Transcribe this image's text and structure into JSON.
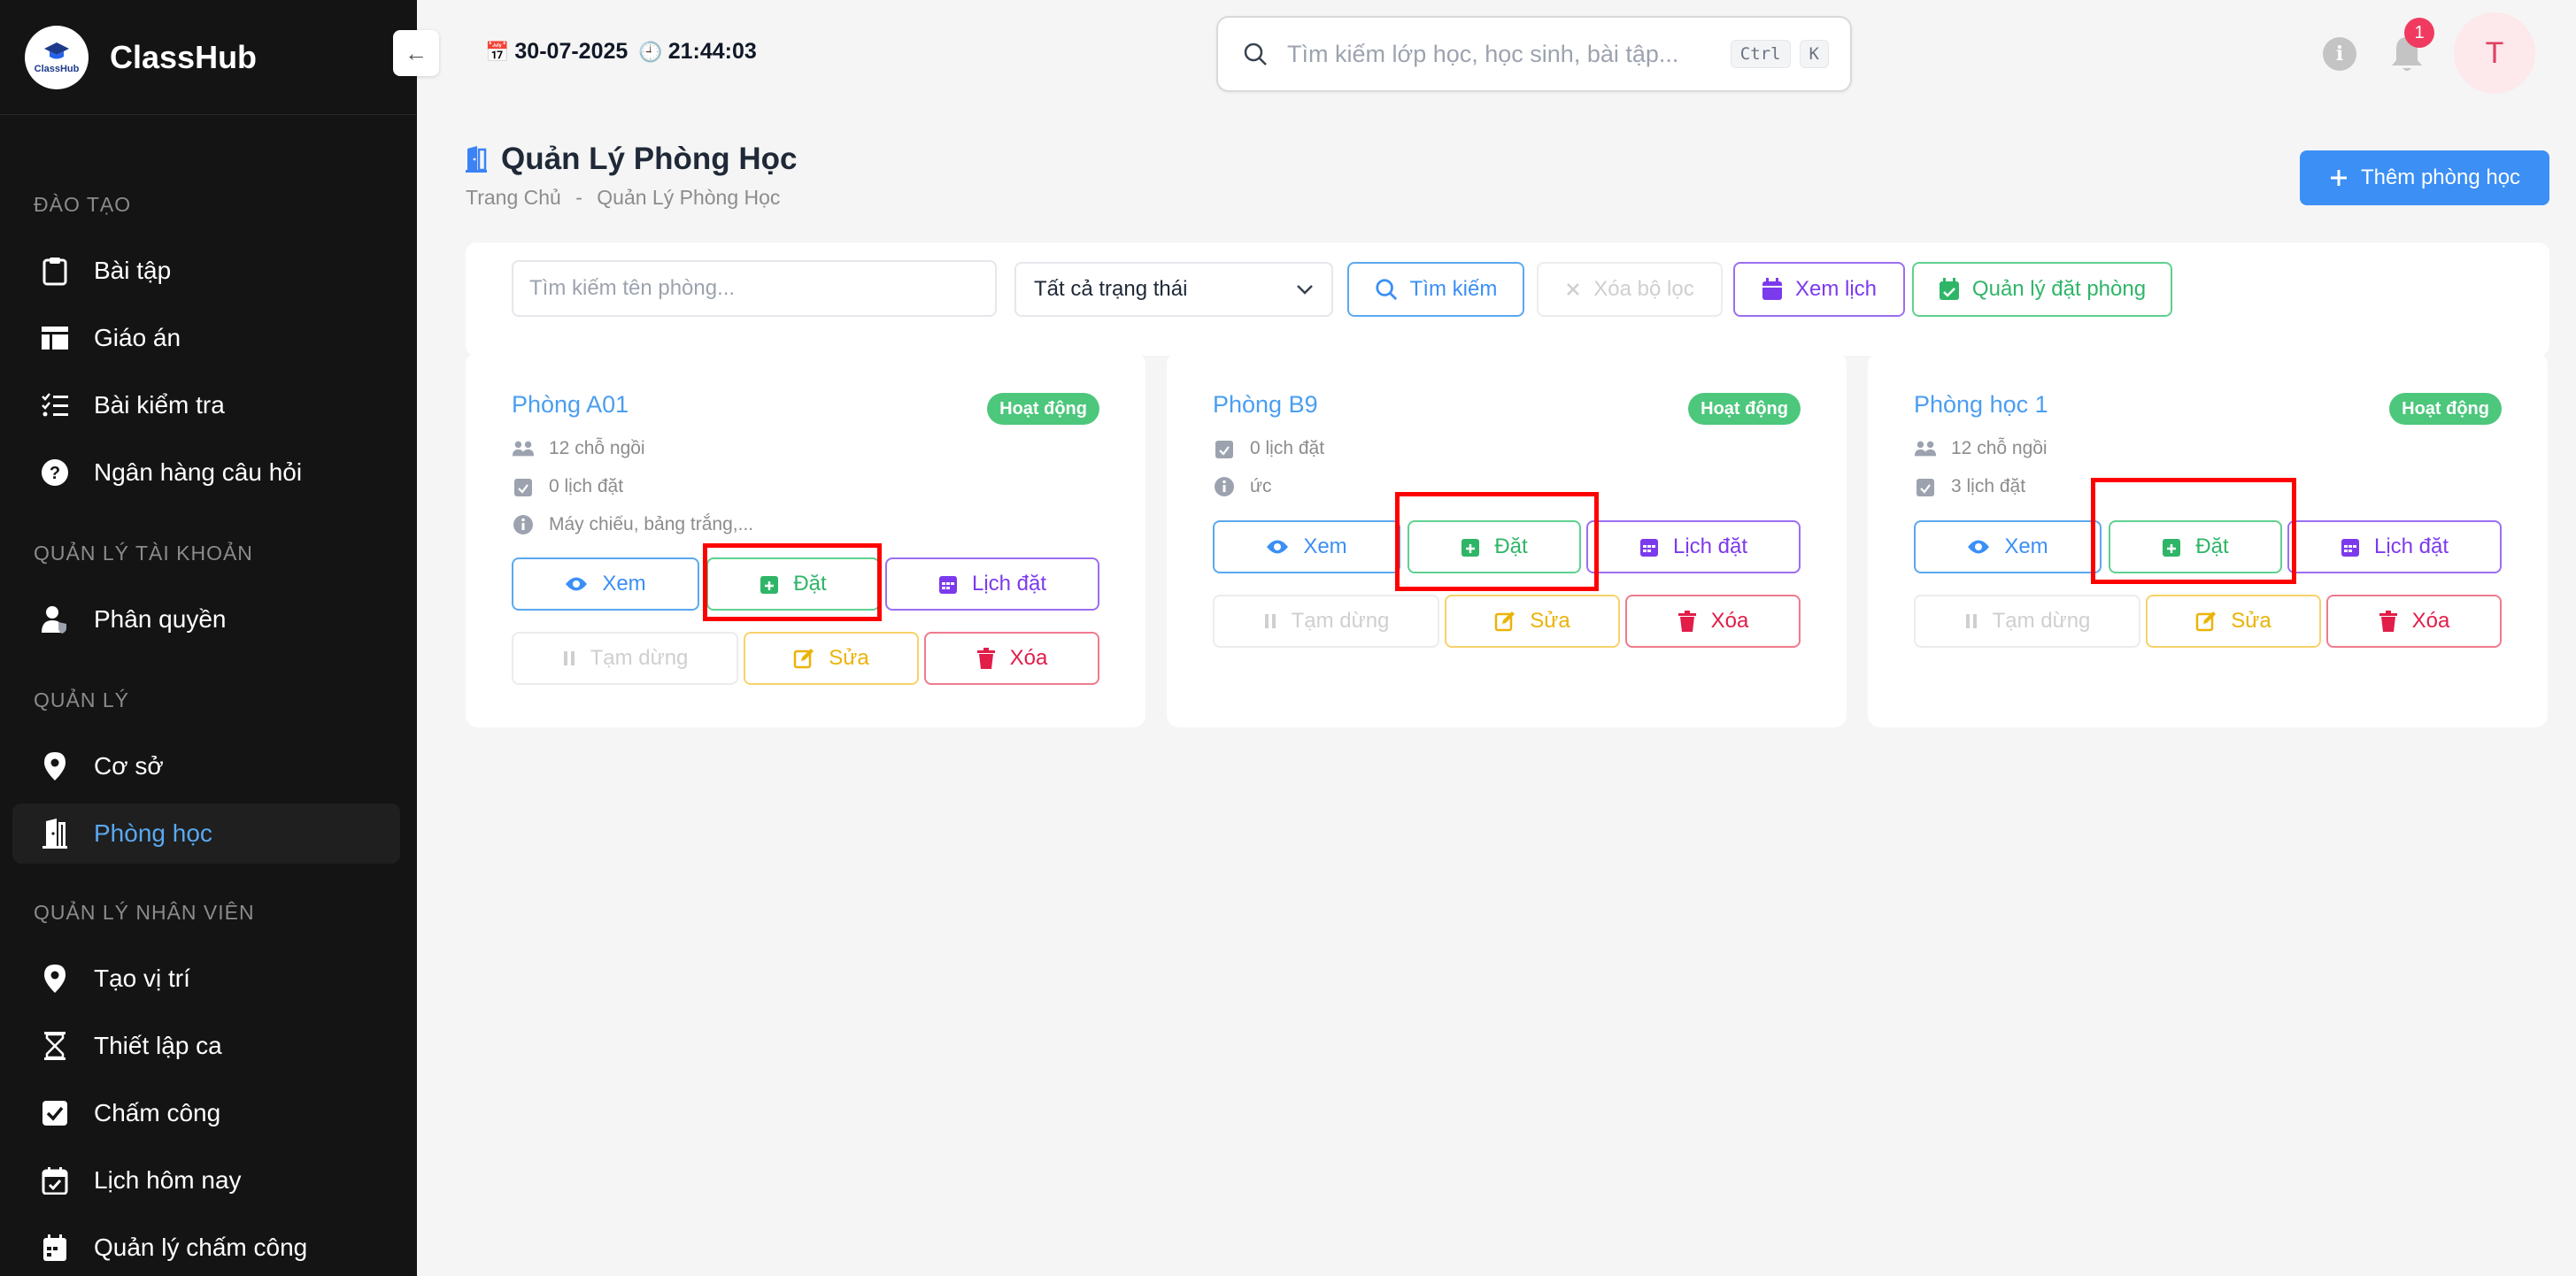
{
  "app": {
    "name": "ClassHub",
    "logo_text": "ClassHub"
  },
  "sidebar": {
    "sections": [
      {
        "title": "ĐÀO TẠO",
        "items": [
          {
            "label": "Bài tập",
            "icon": "clipboard-icon"
          },
          {
            "label": "Giáo án",
            "icon": "layout-icon"
          },
          {
            "label": "Bài kiểm tra",
            "icon": "checklist-icon"
          },
          {
            "label": "Ngân hàng câu hỏi",
            "icon": "question-circle-icon"
          }
        ]
      },
      {
        "title": "QUẢN LÝ TÀI KHOẢN",
        "items": [
          {
            "label": "Phân quyền",
            "icon": "user-shield-icon"
          }
        ]
      },
      {
        "title": "QUẢN LÝ",
        "items": [
          {
            "label": "Cơ sở",
            "icon": "map-pin-icon"
          },
          {
            "label": "Phòng học",
            "icon": "door-icon",
            "active": true
          }
        ]
      },
      {
        "title": "QUẢN LÝ NHÂN VIÊN",
        "items": [
          {
            "label": "Tạo vị trí",
            "icon": "map-pin-icon"
          },
          {
            "label": "Thiết lập ca",
            "icon": "hourglass-icon"
          },
          {
            "label": "Chấm công",
            "icon": "check-square-icon"
          },
          {
            "label": "Lịch hôm nay",
            "icon": "calendar-check-icon"
          },
          {
            "label": "Quản lý chấm công",
            "icon": "calendar-icon"
          }
        ]
      }
    ]
  },
  "header": {
    "date": "30-07-2025",
    "time": "21:44:03",
    "search_placeholder": "Tìm kiếm lớp học, học sinh, bài tập...",
    "shortcut_ctrl": "Ctrl",
    "shortcut_key": "K",
    "notification_count": "1",
    "avatar_initial": "T"
  },
  "page": {
    "title": "Quản Lý Phòng Học",
    "breadcrumb_home": "Trang Chủ",
    "breadcrumb_sep": "-",
    "breadcrumb_current": "Quản Lý Phòng Học",
    "add_button": "Thêm phòng học"
  },
  "filters": {
    "search_placeholder": "Tìm kiếm tên phòng...",
    "status_selected": "Tất cả trạng thái",
    "search_button": "Tìm kiếm",
    "clear_button": "Xóa bộ lọc",
    "calendar_button": "Xem lịch",
    "manage_booking_button": "Quản lý đặt phòng"
  },
  "actions": {
    "view": "Xem",
    "book": "Đặt",
    "schedule": "Lịch đặt",
    "pause": "Tạm dừng",
    "edit": "Sửa",
    "delete": "Xóa"
  },
  "rooms": [
    {
      "name": "Phòng A01",
      "status": "Hoạt động",
      "seats": "12 chỗ ngồi",
      "bookings": "0 lịch đặt",
      "note": "Máy chiếu, bảng trắng,..."
    },
    {
      "name": "Phòng B9",
      "status": "Hoạt động",
      "bookings": "0 lịch đặt",
      "note": "ức"
    },
    {
      "name": "Phòng học 1",
      "status": "Hoạt động",
      "seats": "12 chỗ ngồi",
      "bookings": "3 lịch đặt"
    }
  ],
  "colors": {
    "sidebar_bg": "#141414",
    "accent": "#3b8ff5",
    "status_active": "#4cc77c",
    "highlight": "#ff0000"
  }
}
